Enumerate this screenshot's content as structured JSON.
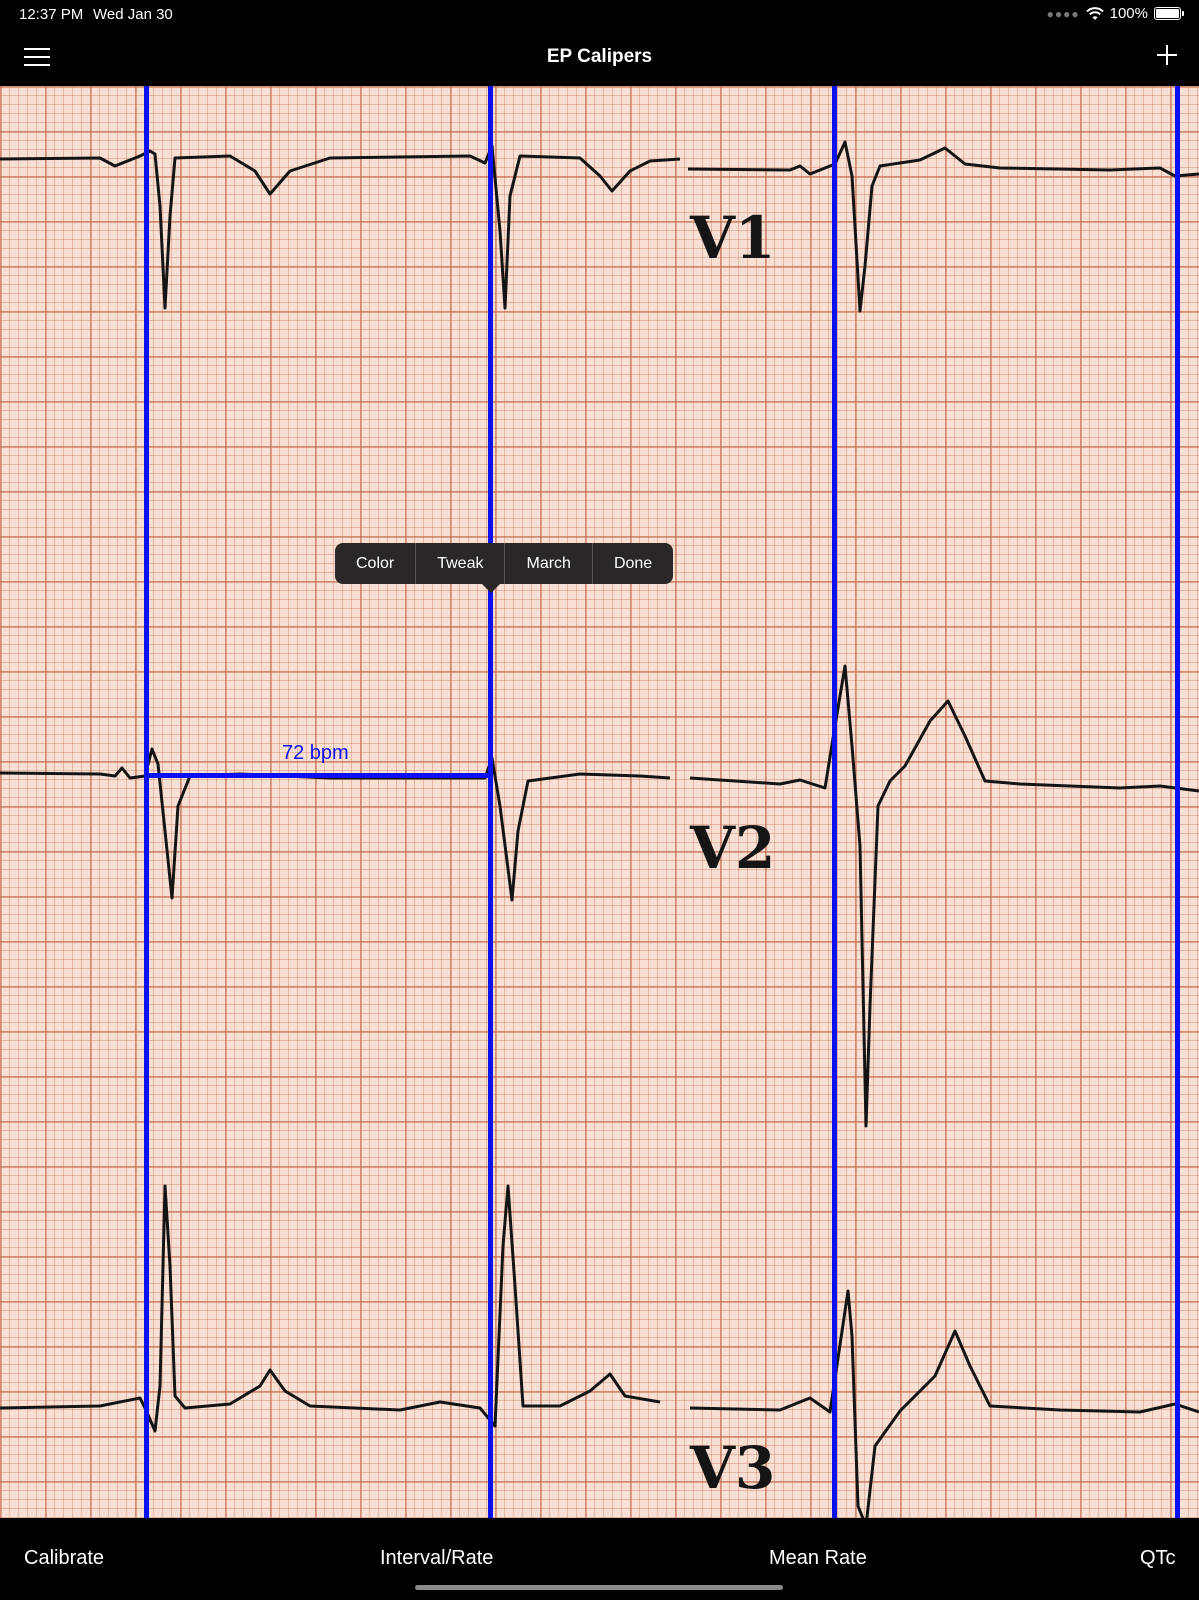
{
  "status_bar": {
    "time": "12:37 PM",
    "date": "Wed Jan 30",
    "battery": "100%"
  },
  "nav": {
    "title": "EP Calipers",
    "menu_icon": "hamburger-menu-icon",
    "add_icon": "plus-icon"
  },
  "ecg": {
    "leads": [
      "V1",
      "V2",
      "V3"
    ],
    "caliper_measurement": "72 bpm",
    "caliper_color": "#0a10f0"
  },
  "context_menu": {
    "items": [
      "Color",
      "Tweak",
      "March",
      "Done"
    ]
  },
  "toolbar": {
    "calibrate": "Calibrate",
    "interval_rate": "Interval/Rate",
    "mean_rate": "Mean Rate",
    "qtc": "QTc"
  }
}
